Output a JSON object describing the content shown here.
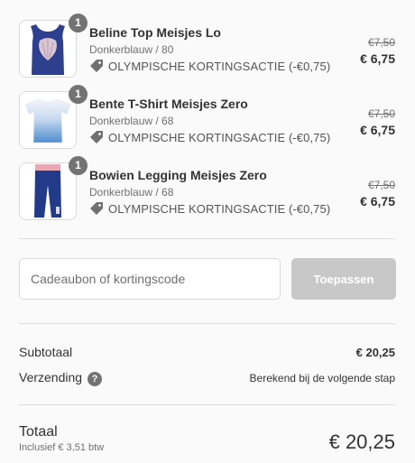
{
  "items": [
    {
      "quantity": "1",
      "name": "Beline Top Meisjes Lo",
      "variant": "Donkerblauw / 80",
      "discount_label": "OLYMPISCHE KORTINGSACTIE (-€0,75)",
      "original_price": "€7,50",
      "price": "€ 6,75",
      "image_icon": "navy-sleeveless-top-with-shell-print"
    },
    {
      "quantity": "1",
      "name": "Bente T-Shirt Meisjes Zero",
      "variant": "Donkerblauw / 68",
      "discount_label": "OLYMPISCHE KORTINGSACTIE (-€0,75)",
      "original_price": "€7,50",
      "price": "€ 6,75",
      "image_icon": "white-blue-ombre-tshirt"
    },
    {
      "quantity": "1",
      "name": "Bowien Legging Meisjes Zero",
      "variant": "Donkerblauw / 68",
      "discount_label": "OLYMPISCHE KORTINGSACTIE (-€0,75)",
      "original_price": "€7,50",
      "price": "€ 6,75",
      "image_icon": "navy-legging-with-pink-waistband"
    }
  ],
  "discount_code": {
    "placeholder": "Cadeaubon of kortingscode",
    "value": "",
    "apply_label": "Toepassen"
  },
  "summary": {
    "subtotal_label": "Subtotaal",
    "subtotal_value": "€ 20,25",
    "shipping_label": "Verzending",
    "shipping_help_icon": "?",
    "shipping_value": "Berekend bij de volgende stap",
    "total_label": "Totaal",
    "tax_note": "Inclusief € 3,51 btw",
    "total_currency": "€",
    "total_value": "20,25"
  },
  "colors": {
    "background": "#fafafa",
    "badge": "#737373",
    "button_disabled": "#c8c8c8",
    "text": "#333333",
    "muted": "#707070"
  }
}
